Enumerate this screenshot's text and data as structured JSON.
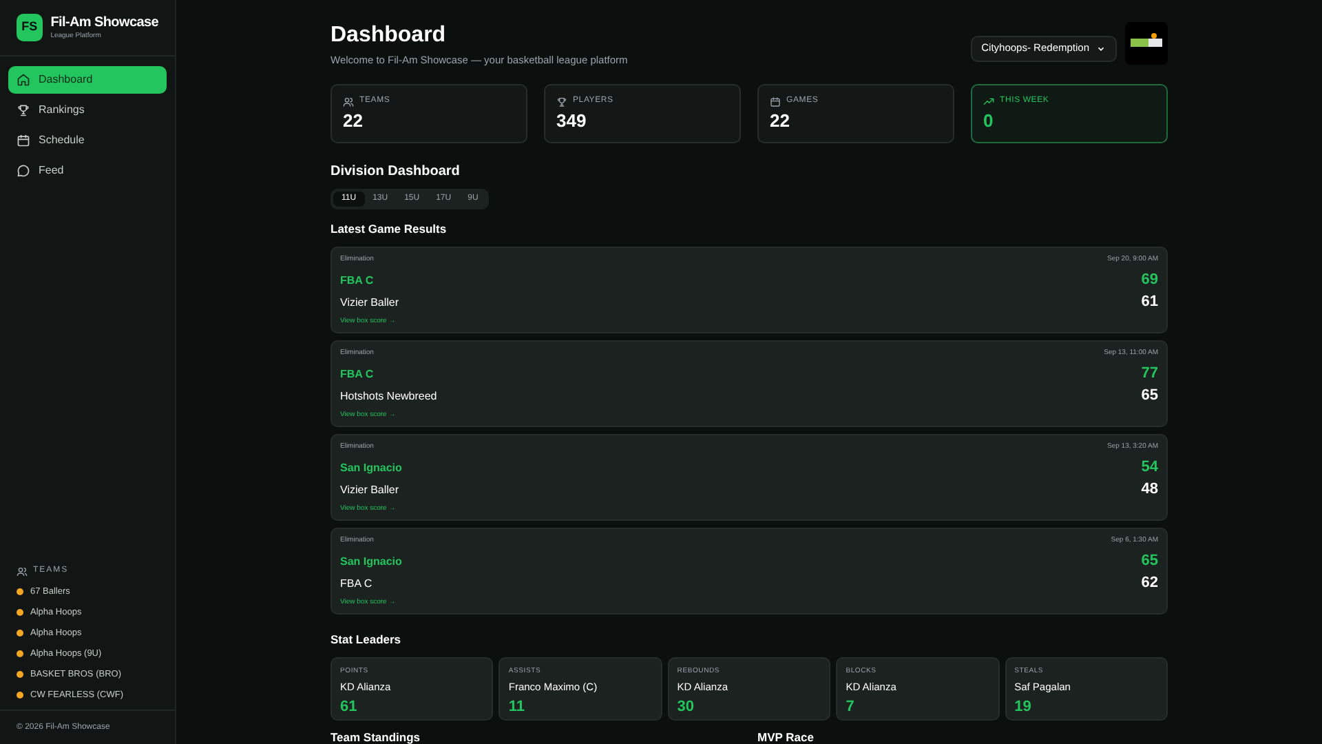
{
  "brand": {
    "initials": "FS",
    "name": "Fil-Am Showcase",
    "tagline": "League Platform"
  },
  "nav": [
    {
      "label": "Dashboard",
      "kind": "home",
      "selected": true
    },
    {
      "label": "Rankings",
      "kind": "trophy",
      "selected": false
    },
    {
      "label": "Schedule",
      "kind": "calendar",
      "selected": false
    },
    {
      "label": "Feed",
      "kind": "chat",
      "selected": false
    }
  ],
  "teams": {
    "heading": "TEAMS",
    "items": [
      {
        "name": "67 Ballers",
        "color": "#f5a623"
      },
      {
        "name": "Alpha Hoops",
        "color": "#f5a623"
      },
      {
        "name": "Alpha Hoops",
        "color": "#f5a623"
      },
      {
        "name": "Alpha Hoops (9U)",
        "color": "#f5a623"
      },
      {
        "name": "BASKET BROS (BRO)",
        "color": "#f5a623"
      },
      {
        "name": "CW FEARLESS (CWF)",
        "color": "#f5a623"
      }
    ]
  },
  "footer": "© 2026 Fil-Am Showcase",
  "header": {
    "title": "Dashboard",
    "subtitle": "Welcome to Fil-Am Showcase — your basketball league platform",
    "league_select": "Cityhoops- Redemption"
  },
  "stats": [
    {
      "label": "TEAMS",
      "value": "22",
      "kind": "users",
      "highlight": false
    },
    {
      "label": "PLAYERS",
      "value": "349",
      "kind": "trophy",
      "highlight": false
    },
    {
      "label": "GAMES",
      "value": "22",
      "kind": "calendar",
      "highlight": false
    },
    {
      "label": "THIS WEEK",
      "value": "0",
      "kind": "trend",
      "highlight": true
    }
  ],
  "division": {
    "title": "Division Dashboard",
    "tabs": [
      {
        "label": "11U",
        "selected": true
      },
      {
        "label": "13U",
        "selected": false
      },
      {
        "label": "15U",
        "selected": false
      },
      {
        "label": "17U",
        "selected": false
      },
      {
        "label": "9U",
        "selected": false
      }
    ]
  },
  "games": {
    "title": "Latest Game Results",
    "items": [
      {
        "stage": "Elimination",
        "date": "Sep 20, 9:00 AM",
        "teams": [
          {
            "name": "FBA C",
            "score": "69",
            "winner": true
          },
          {
            "name": "Vizier Baller",
            "score": "61",
            "winner": false
          }
        ],
        "link": "View box score →"
      },
      {
        "stage": "Elimination",
        "date": "Sep 13, 11:00 AM",
        "teams": [
          {
            "name": "FBA C",
            "score": "77",
            "winner": true
          },
          {
            "name": "Hotshots Newbreed",
            "score": "65",
            "winner": false
          }
        ],
        "link": "View box score →"
      },
      {
        "stage": "Elimination",
        "date": "Sep 13, 3:20 AM",
        "teams": [
          {
            "name": "San Ignacio",
            "score": "54",
            "winner": true
          },
          {
            "name": "Vizier Baller",
            "score": "48",
            "winner": false
          }
        ],
        "link": "View box score →"
      },
      {
        "stage": "Elimination",
        "date": "Sep 6, 1:30 AM",
        "teams": [
          {
            "name": "San Ignacio",
            "score": "65",
            "winner": true
          },
          {
            "name": "FBA C",
            "score": "62",
            "winner": false
          }
        ],
        "link": "View box score →"
      }
    ]
  },
  "leaders": {
    "title": "Stat Leaders",
    "items": [
      {
        "category": "POINTS",
        "player": "KD Alianza",
        "value": "61"
      },
      {
        "category": "ASSISTS",
        "player": "Franco Maximo (C)",
        "value": "11"
      },
      {
        "category": "REBOUNDS",
        "player": "KD Alianza",
        "value": "30"
      },
      {
        "category": "BLOCKS",
        "player": "KD Alianza",
        "value": "7"
      },
      {
        "category": "STEALS",
        "player": "Saf Pagalan",
        "value": "19"
      }
    ]
  },
  "sections": [
    "Team Standings",
    "MVP Race"
  ]
}
